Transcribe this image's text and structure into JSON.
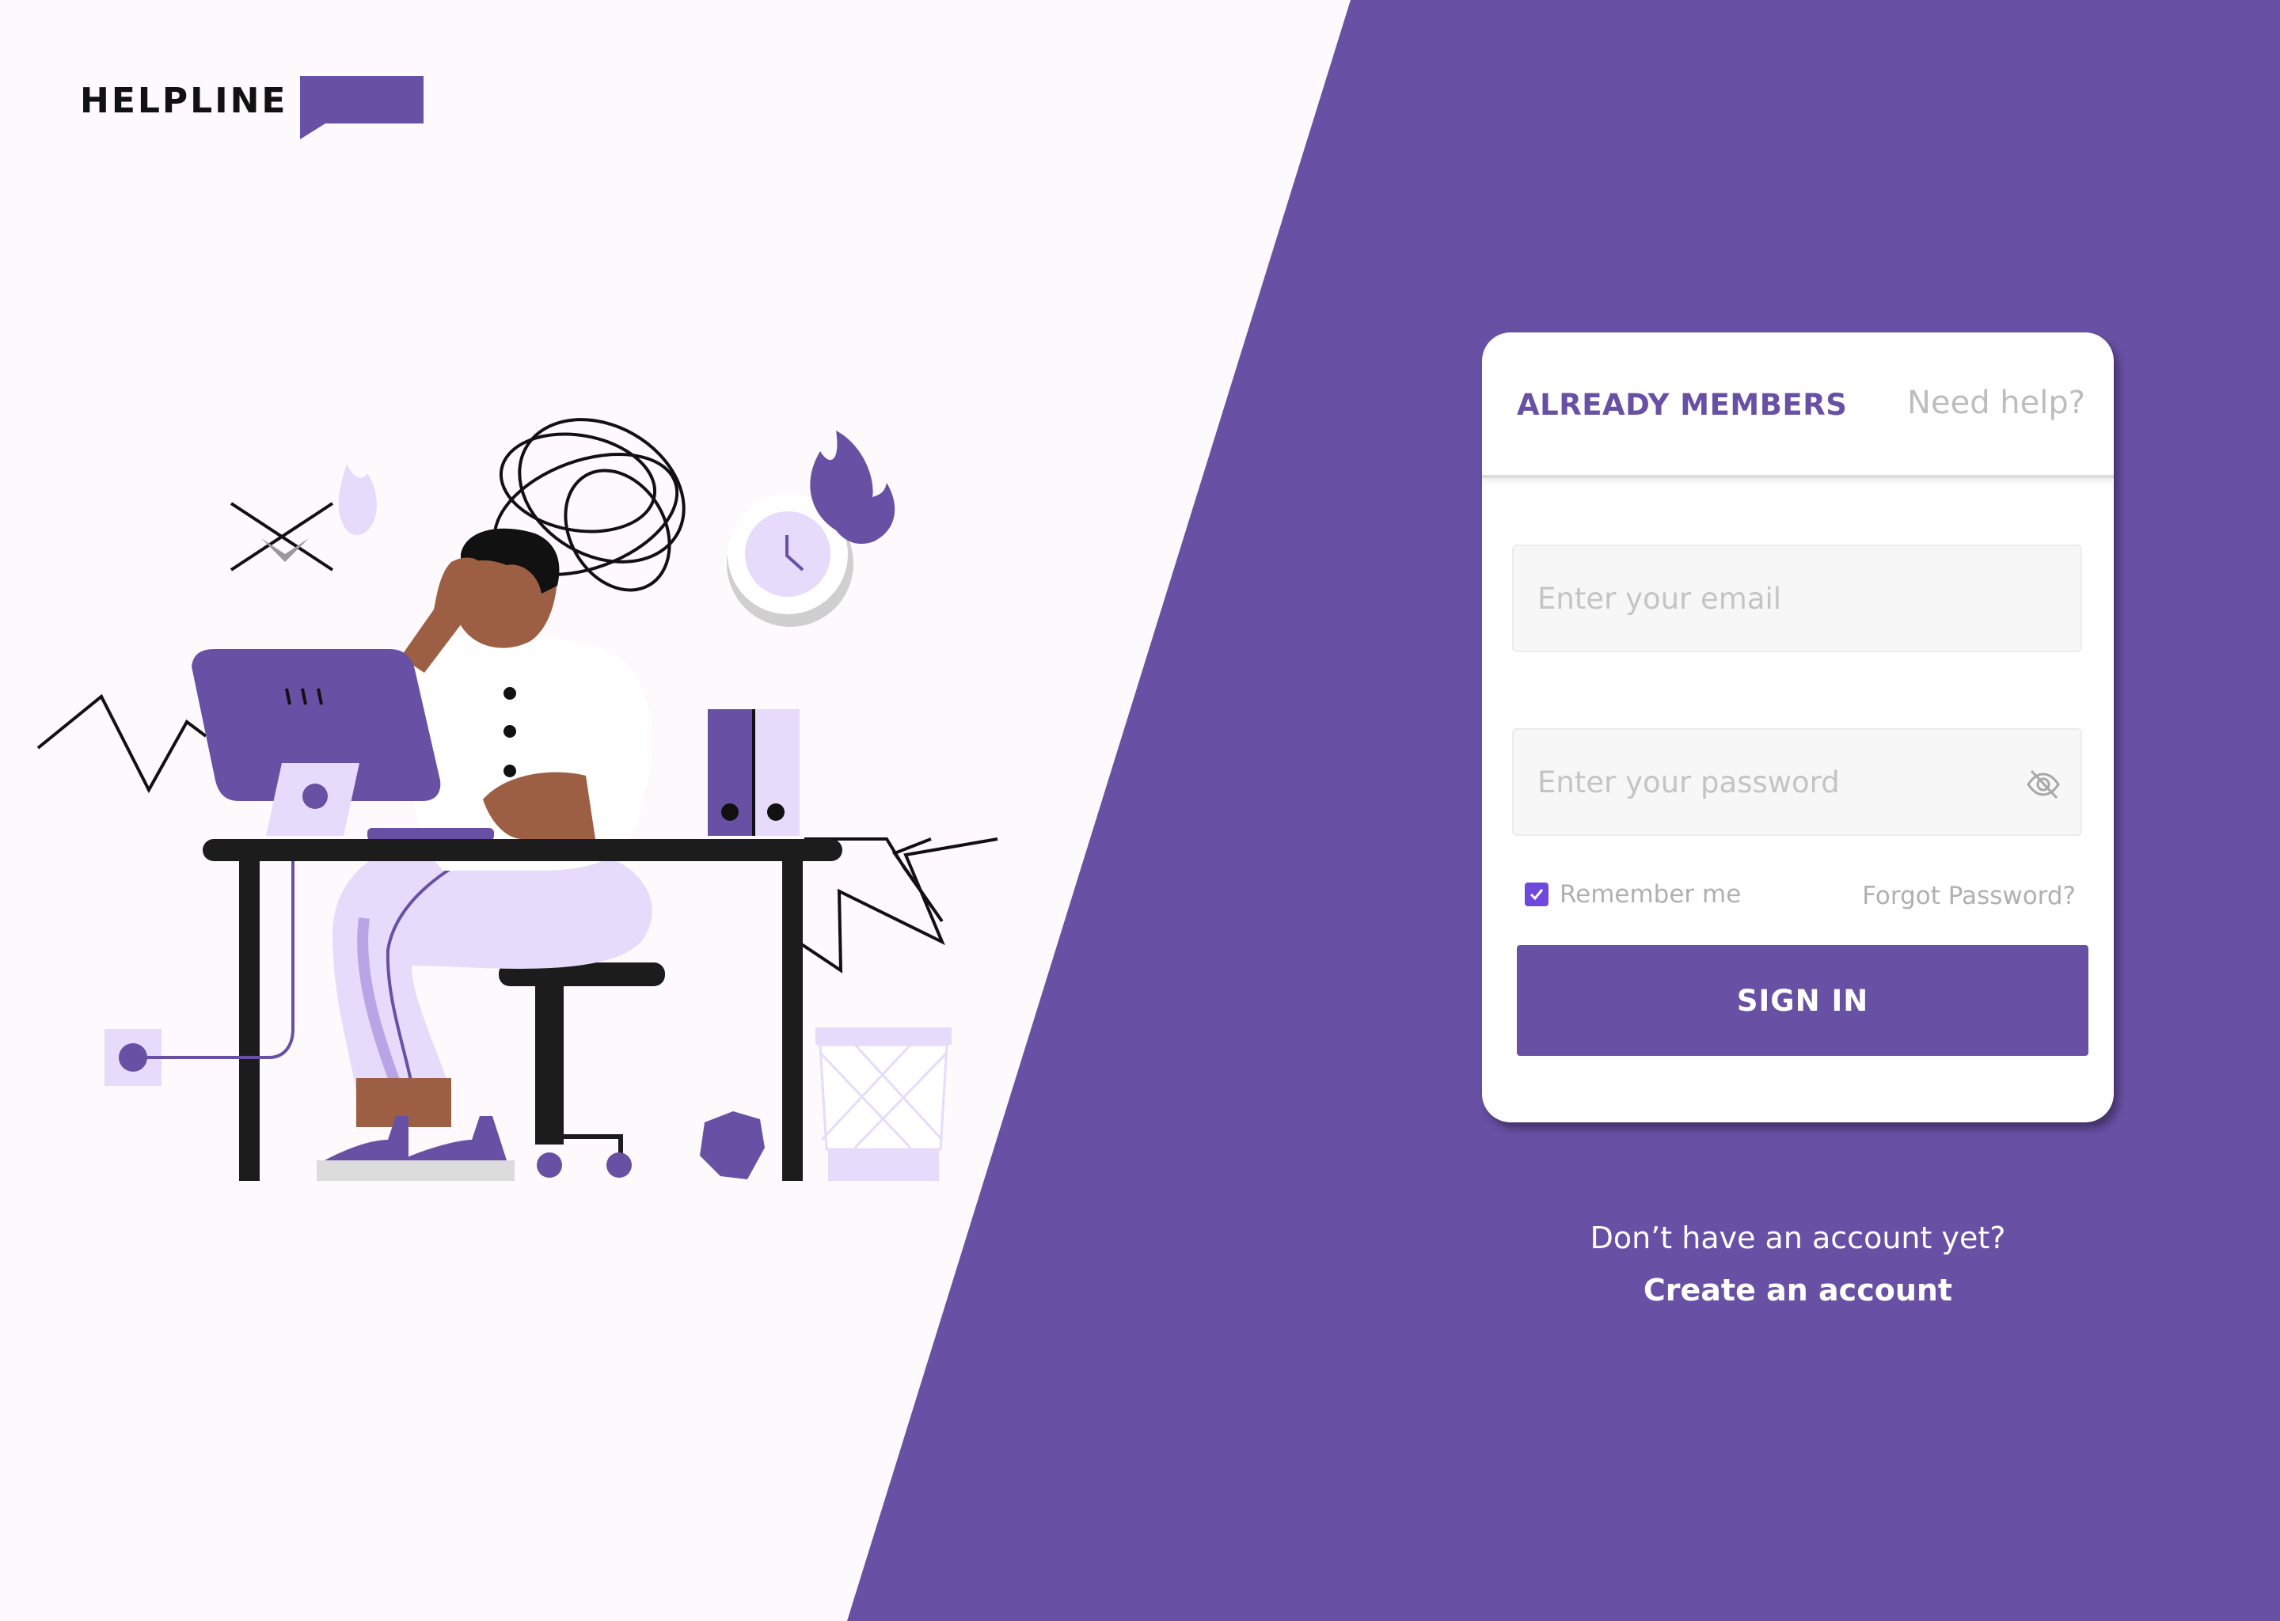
{
  "brand": {
    "name": "HELPLINE"
  },
  "colors": {
    "accent": "#6850a4",
    "background": "#fdf9fc",
    "light_purple": "#e6dbfb",
    "checkbox": "#6e49dc"
  },
  "login_card": {
    "tab_active": "ALREADY MEMBERS",
    "tab_help": "Need help?",
    "email_placeholder": "Enter your email",
    "password_placeholder": "Enter your password",
    "password_toggle_icon": "eye-off-icon",
    "remember_label": "Remember me",
    "remember_checked": true,
    "forgot_label": "Forgot Password?",
    "signin_label": "SIGN IN"
  },
  "signup": {
    "prompt": "Don’t have an account yet?",
    "link": "Create an account"
  },
  "illustration": {
    "subject": "stressed person at desk with computer"
  }
}
